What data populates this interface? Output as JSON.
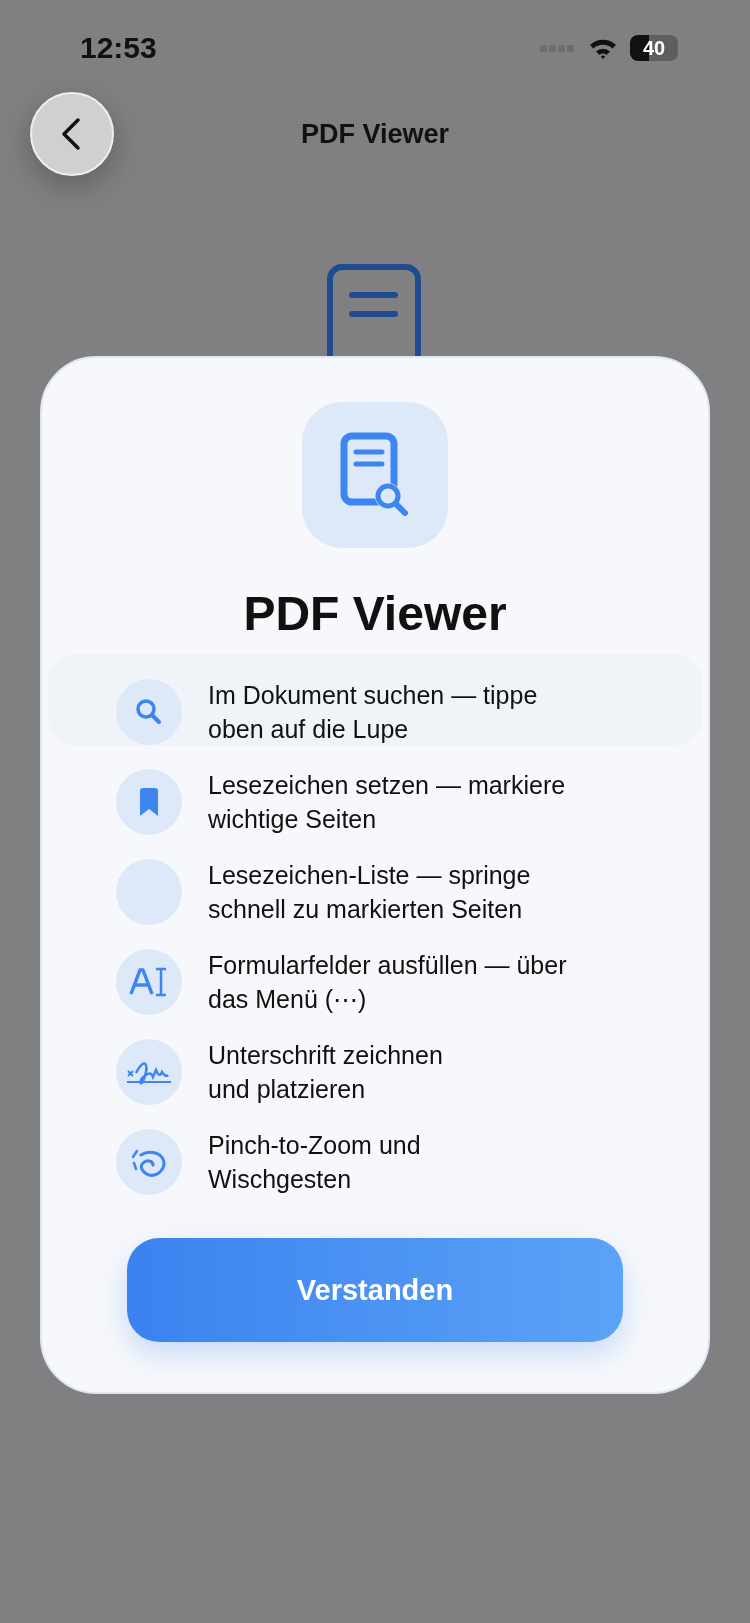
{
  "status_bar": {
    "time": "12:53",
    "battery": "40"
  },
  "nav": {
    "title": "PDF Viewer"
  },
  "dialog": {
    "title": "PDF Viewer",
    "features": [
      {
        "kind": "search",
        "text": "Im Dokument suchen — tippe oben auf die Lupe"
      },
      {
        "kind": "bookmark",
        "text": "Lesezeichen setzen — markiere wichtige Seiten"
      },
      {
        "kind": "blank",
        "text": "Lesezeichen-Liste — springe schnell zu markierten Seiten"
      },
      {
        "kind": "text-field",
        "text": "Formularfelder ausfüllen — über das Menü (⋯)"
      },
      {
        "kind": "signature",
        "text": "Unterschrift zeichnen\nund platzieren"
      },
      {
        "kind": "gesture",
        "text": "Pinch-to-Zoom und\nWischgesten"
      }
    ],
    "button": "Verstanden"
  }
}
